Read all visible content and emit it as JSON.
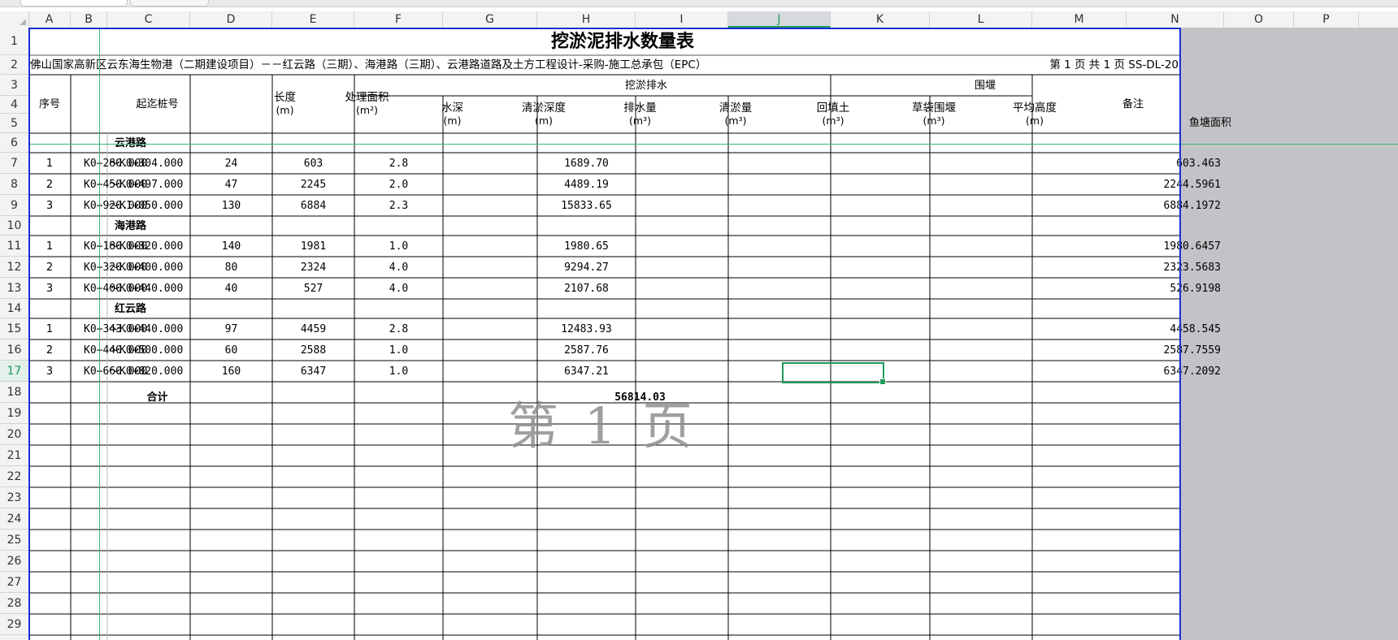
{
  "columns": [
    "A",
    "B",
    "C",
    "D",
    "E",
    "F",
    "G",
    "H",
    "I",
    "J",
    "K",
    "L",
    "M",
    "N",
    "O",
    "P"
  ],
  "active_column": "J",
  "active_row": "17",
  "rows": [
    "1",
    "2",
    "3",
    "4",
    "5",
    "6",
    "7",
    "8",
    "9",
    "10",
    "11",
    "12",
    "13",
    "14",
    "15",
    "16",
    "17",
    "18",
    "19",
    "20",
    "21",
    "22",
    "23",
    "24",
    "25",
    "26",
    "27",
    "28",
    "29"
  ],
  "sheet": {
    "title": "挖淤泥排水数量表",
    "subtitle": "佛山国家高新区云东海生物港（二期建设项目）－－红云路（三期）、海港路（三期）、云港路道路及土方工程设计-采购-施工总承包（EPC）",
    "page_info": "第 1 页  共 1 页  SS-DL-20",
    "headers": {
      "seq": "序号",
      "station": "起迄桩号",
      "length": "长度",
      "length_unit": "(m)",
      "area": "处理面积",
      "area_unit": "(m²)",
      "group_dig": "挖淤排水",
      "depth": "水深",
      "depth_unit": "(m)",
      "clear_depth": "清淤深度",
      "clear_depth_unit": "(m)",
      "drain": "排水量",
      "drain_unit": "(m³)",
      "clear_vol": "清淤量",
      "clear_vol_unit": "(m³)",
      "backfill": "回填土",
      "backfill_unit": "(m³)",
      "group_weir": "围堰",
      "bag_weir": "草袋围堰",
      "bag_weir_unit": "(m³)",
      "avg_height": "平均高度",
      "avg_height_unit": "(m)",
      "remark": "备注",
      "fish_pond": "鱼塘面积"
    },
    "sections": [
      {
        "name": "云港路",
        "rows": [
          {
            "seq": "1",
            "from": "K0+280.000",
            "to": "～K0+304.000",
            "length": "24",
            "area": "603",
            "depth": "2.8",
            "drain": "1689.70",
            "pond": "603.463"
          },
          {
            "seq": "2",
            "from": "K0+450.000",
            "to": "～K0+497.000",
            "length": "47",
            "area": "2245",
            "depth": "2.0",
            "drain": "4489.19",
            "pond": "2244.5961"
          },
          {
            "seq": "3",
            "from": "K0+920.000",
            "to": "～K1+050.000",
            "length": "130",
            "area": "6884",
            "depth": "2.3",
            "drain": "15833.65",
            "pond": "6884.1972"
          }
        ]
      },
      {
        "name": "海港路",
        "rows": [
          {
            "seq": "1",
            "from": "K0+180.000",
            "to": "～K0+320.000",
            "length": "140",
            "area": "1981",
            "depth": "1.0",
            "drain": "1980.65",
            "pond": "1980.6457"
          },
          {
            "seq": "2",
            "from": "K0+320.000",
            "to": "～K0+400.000",
            "length": "80",
            "area": "2324",
            "depth": "4.0",
            "drain": "9294.27",
            "pond": "2323.5683"
          },
          {
            "seq": "3",
            "from": "K0+400.000",
            "to": "～K0+440.000",
            "length": "40",
            "area": "527",
            "depth": "4.0",
            "drain": "2107.68",
            "pond": "526.9198"
          }
        ]
      },
      {
        "name": "红云路",
        "rows": [
          {
            "seq": "1",
            "from": "K0+343.000",
            "to": "～K0+440.000",
            "length": "97",
            "area": "4459",
            "depth": "2.8",
            "drain": "12483.93",
            "pond": "4458.545"
          },
          {
            "seq": "2",
            "from": "K0+440.000",
            "to": "～K0+500.000",
            "length": "60",
            "area": "2588",
            "depth": "1.0",
            "drain": "2587.76",
            "pond": "2587.7559"
          },
          {
            "seq": "3",
            "from": "K0+660.000",
            "to": "～K0+820.000",
            "length": "160",
            "area": "6347",
            "depth": "1.0",
            "drain": "6347.21",
            "pond": "6347.2092"
          }
        ]
      }
    ],
    "total_label": "合计",
    "total_drain": "56814.03",
    "watermark": "第 1 页"
  }
}
